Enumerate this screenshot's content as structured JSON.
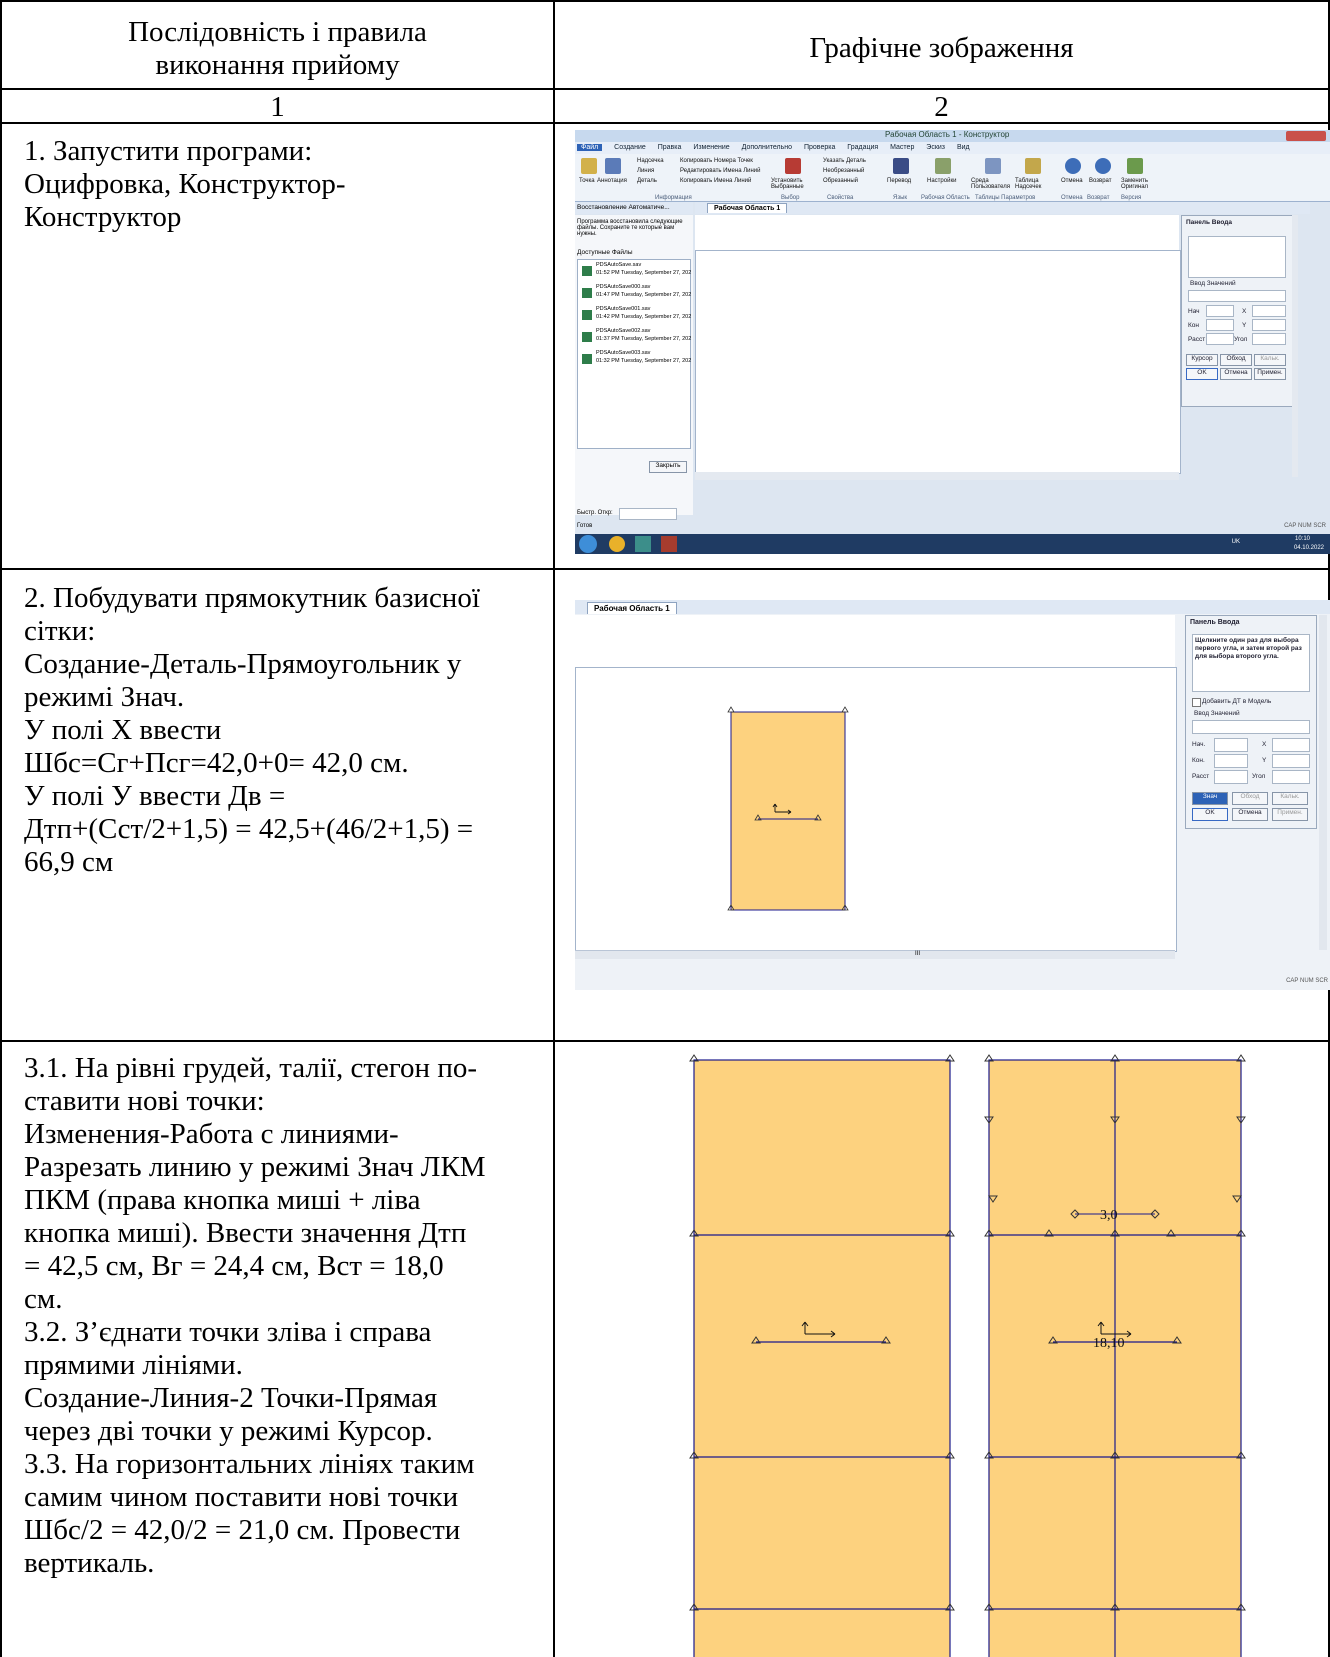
{
  "table": {
    "header_left": "Послідовність і правила\nвиконання прийому",
    "header_right": "Графічне зображення",
    "col_num_left": "1",
    "col_num_right": "2",
    "row1_text": "1. Запустити програми:\nОцифровка, Конструктор-\nКонструктор",
    "row2_text": "2. Побудувати прямокутник базисної\nсітки:\nСоздание-Деталь-Прямоугольник у\nрежимі Знач.\nУ полі Х ввести\nШбс=Сг+Пcг=42,0+0= 42,0 см.\nУ полі У ввести Дв =\nДтп+(Сст/2+1,5) = 42,5+(46/2+1,5) =\n66,9 см",
    "row3_text": "3.1. На рівні грудей, талії, стегон по-\nставити нові точки:\nИзменения-Работа с линиями-\nРазрезать линию у режимі Знач ЛКМ\nПКМ (права кнопка миші + ліва\nкнопка миші). Ввести значення Дтп\n= 42,5 см, Вг = 24,4 см, Вст = 18,0\nсм.\n3.2. З’єднати точки зліва і справа\nпрямими лініями.\nСоздание-Линия-2 Точки-Прямая\nчерез дві точки у режимі Курсор.\n3.3. На горизонтальних лініях таким\nсамим чином поставити нові точки\nШбс/2 = 42,0/2 = 21,0 см. Провести\nвертикаль."
  },
  "shot1": {
    "app_title": "Рабочая Область 1 - Конструктор",
    "menu": [
      "Файл",
      "Создание",
      "Правка",
      "Изменение",
      "Дополнительно",
      "Проверка",
      "Градация",
      "Мастер",
      "Эскиз",
      "Вид"
    ],
    "ribbon_buttons": [
      "Точка",
      "Аннотация",
      "Надсечка",
      "Линия",
      "Деталь",
      "Копировать Номера Точек",
      "Редактировать Имена Линий",
      "Копировать Имена Линий",
      "Установить Выбранные",
      "Указать Деталь",
      "Необрезанный",
      "Обрезанный",
      "Перевод",
      "Настройки",
      "Среда Пользователя",
      "Таблица Надсечек",
      "Отмена",
      "Возврат",
      "Заменить Оригинал"
    ],
    "ribbon_groups": [
      "Информация",
      "Выбор",
      "Свойства",
      "Язык",
      "Рабочая Область",
      "Таблицы Параметров",
      "Отмена",
      "Возврат",
      "Версия"
    ],
    "left_panel_title": "Восстановление Автоматиче...",
    "left_panel_msg": "Программа восстановила следующие файлы. Сохраните те которые вам нужны.",
    "left_panel_list_title": "Доступные Файлы",
    "files": [
      {
        "name": "PDSAutoSave.sav",
        "time": "01:52 PM Tuesday, September 27, 202"
      },
      {
        "name": "PDSAutoSave000.sav",
        "time": "01:47 PM Tuesday, September 27, 202"
      },
      {
        "name": "PDSAutoSave001.sav",
        "time": "01:42 PM Tuesday, September 27, 202"
      },
      {
        "name": "PDSAutoSave002.sav",
        "time": "01:37 PM Tuesday, September 27, 202"
      },
      {
        "name": "PDSAutoSave003.sav",
        "time": "01:32 PM Tuesday, September 27, 202"
      }
    ],
    "close_button": "Закрыть",
    "quick_open_label": "Быстр. Откр:",
    "status_ready": "Готов",
    "status_right": "CAP NUM SCR",
    "tab_label": "Рабочая Область 1",
    "panel_title": "Панель Ввода",
    "panel_value_label": "Ввод Значений",
    "panel_labels": [
      "Нач",
      "Кон",
      "Расст",
      "X",
      "Y",
      "Угол"
    ],
    "panel_buttons_row1": [
      "Курсор",
      "Обход",
      "Кальк."
    ],
    "panel_buttons_row2": [
      "OK",
      "Отмена",
      "Примен."
    ],
    "tray_lang": "UK",
    "tray_time": "10:10",
    "tray_date": "04.10.2022"
  },
  "shot2": {
    "tab_label": "Рабочая Область 1",
    "panel_title": "Панель Ввода",
    "panel_hint": "Щелкните один раз для выбора первого угла, и затем второй раз для выбора второго угла.",
    "checkbox_label": "Добавить ДТ в Модель",
    "panel_value_label": "Ввод Значений",
    "panel_labels": [
      "Нач.",
      "Кон.",
      "Расст",
      "X",
      "Y",
      "Угол"
    ],
    "panel_buttons_row1": [
      "Знач",
      "Обход",
      "Кальк."
    ],
    "panel_buttons_row2": [
      "OK",
      "Отмена",
      "Примен."
    ],
    "scroll_marker": "III",
    "status_right": "CAP NUM SCR"
  },
  "shot3": {
    "label_top": "3,0",
    "label_mid": "18,10"
  },
  "colors": {
    "piece_fill": "#fdd27f",
    "piece_line": "#1c1a8c",
    "ribbon_blue": "#2d62b6"
  }
}
